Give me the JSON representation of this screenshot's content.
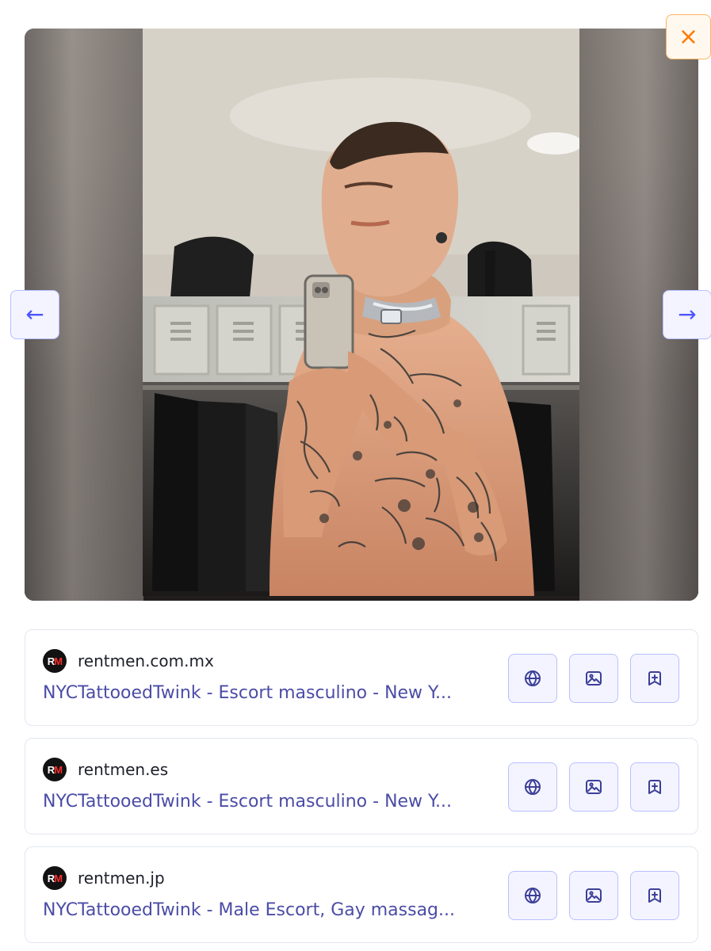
{
  "viewer": {
    "prev_label": "←",
    "next_label": "→",
    "close_label": "×"
  },
  "results": [
    {
      "site": "rentmen.com.mx",
      "title": "NYCTattooedTwink - Escort masculino - New Y...",
      "logo_text": {
        "left": "R",
        "right": "M"
      }
    },
    {
      "site": "rentmen.es",
      "title": "NYCTattooedTwink - Escort masculino - New Y...",
      "logo_text": {
        "left": "R",
        "right": "M"
      }
    },
    {
      "site": "rentmen.jp",
      "title": "NYCTattooedTwink - Male Escort, Gay massag...",
      "logo_text": {
        "left": "R",
        "right": "M"
      }
    }
  ],
  "icons": {
    "globe": "globe-icon",
    "image": "image-icon",
    "bookmark": "bookmark-plus-icon",
    "close": "close-icon",
    "prev": "arrow-left-icon",
    "next": "arrow-right-icon"
  },
  "colors": {
    "accent": "#4d55ff",
    "accent_bg": "#f3f4ff",
    "close_accent": "#ff7a00",
    "link": "#4b4ca6"
  }
}
